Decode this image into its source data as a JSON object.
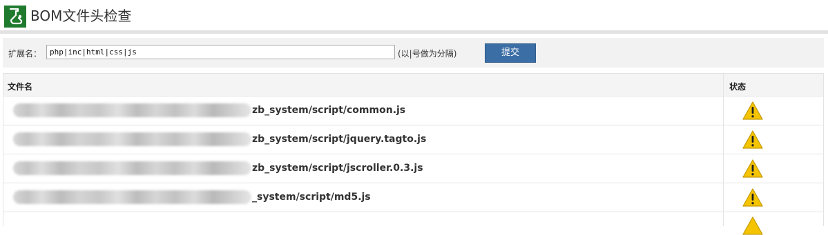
{
  "header": {
    "title": "BOM文件头检查",
    "logo_icon": "flask-icon"
  },
  "toolbar": {
    "ext_label": "扩展名：",
    "ext_value": "php|inc|html|css|js",
    "ext_hint": "(以|号做为分隔)",
    "submit_label": "提交"
  },
  "table": {
    "headers": {
      "name": "文件名",
      "status": "状态"
    },
    "rows": [
      {
        "path": "zb_system/script/common.js",
        "status_icon": "warning-icon"
      },
      {
        "path": "zb_system/script/jquery.tagto.js",
        "status_icon": "warning-icon"
      },
      {
        "path": "zb_system/script/jscroller.0.3.js",
        "status_icon": "warning-icon"
      },
      {
        "path": "_system/script/md5.js",
        "status_icon": "warning-icon"
      }
    ]
  },
  "colors": {
    "logo_green": "#1f7a2e",
    "button_blue": "#3b6ea5",
    "warning_yellow": "#f5c400"
  }
}
